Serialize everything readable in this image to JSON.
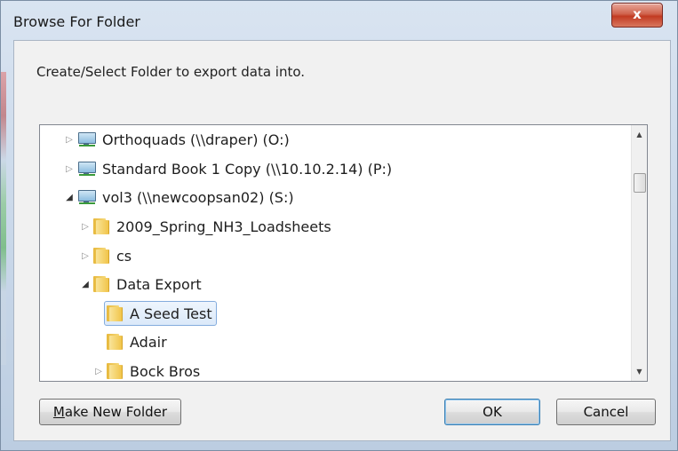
{
  "window": {
    "title": "Browse For Folder",
    "close_label": "x"
  },
  "instruction": "Create/Select Folder to export data into.",
  "tree": {
    "items": [
      {
        "label": "Orthoquads (\\\\draper) (O:)",
        "type": "drive",
        "expanded": false,
        "level": 0
      },
      {
        "label": "Standard Book 1 Copy (\\\\10.10.2.14) (P:)",
        "type": "drive",
        "expanded": false,
        "level": 0
      },
      {
        "label": "vol3 (\\\\newcoopsan02) (S:)",
        "type": "drive",
        "expanded": true,
        "level": 0
      },
      {
        "label": "2009_Spring_NH3_Loadsheets",
        "type": "folder",
        "expanded": false,
        "level": 1
      },
      {
        "label": "cs",
        "type": "folder",
        "expanded": false,
        "level": 1
      },
      {
        "label": "Data Export",
        "type": "folder",
        "expanded": true,
        "level": 1
      },
      {
        "label": "A Seed Test",
        "type": "folder",
        "selected": true,
        "level": 2
      },
      {
        "label": "Adair",
        "type": "folder",
        "level": 2
      },
      {
        "label": "Bock Bros",
        "type": "folder",
        "expanded": false,
        "level": 2
      }
    ]
  },
  "buttons": {
    "make_new_folder_first": "M",
    "make_new_folder_rest": "ake New Folder",
    "ok": "OK",
    "cancel": "Cancel"
  },
  "colors": {
    "accent": "#3c7fb1",
    "close_red": "#c23b22"
  }
}
